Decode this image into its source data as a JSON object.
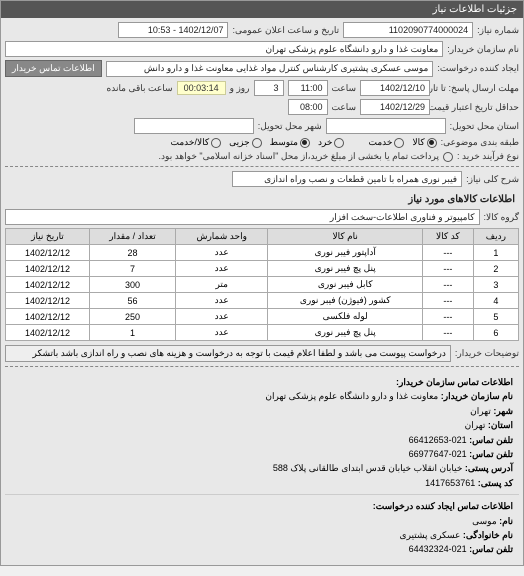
{
  "header": "جزئیات اطلاعات نیاز",
  "form": {
    "request_no_label": "شماره نیاز:",
    "request_no": "1102090774000024",
    "publish_label": "تاریخ و ساعت اعلان عمومی:",
    "publish_value": "1402/12/07 - 10:53",
    "buyer_label": "نام سازمان خریدار:",
    "buyer_value": "معاونت غذا و دارو دانشگاه علوم پزشکی تهران",
    "creator_label": "ایجاد کننده درخواست:",
    "creator_value": "موسی   عسکری پشتیری   کارشناس کنترل مواد غذایی معاونت غذا و دارو دانش",
    "contact_btn": "اطلاعات تماس خریدار",
    "deadline_send_label": "مهلت ارسال پاسخ: تا تاریخ:",
    "deadline_send_date": "1402/12/10",
    "time_label": "ساعت",
    "deadline_send_time": "11:00",
    "days_left": "3",
    "days_left_label": "روز و",
    "countdown": "00:03:14",
    "remain_label": "ساعت باقی مانده",
    "validity_label": "حداقل تاریخ اعتبار قیمت: تا تاریخ:",
    "validity_date": "1402/12/29",
    "validity_time": "08:00",
    "province_label": "استان محل تحویل:",
    "city_label": "شهر محل تحویل:",
    "pack_label": "طبقه بندی موضوعی:",
    "pack_goods": "کالا",
    "pack_service": "خدمت",
    "pack_small": "خرد",
    "pack_medium": "متوسط",
    "pack_partial": "جزیی",
    "pack_both": "کالا/خدمت",
    "process_label": "نوع فرآیند خرید :",
    "process_text": "پرداخت تمام یا بخشی از مبلغ خرید،از محل \"اسناد خزانه اسلامی\" خواهد بود.",
    "desc_label": "شرح کلی نیاز:",
    "desc_value": "فیبر نوری همراه با تامین قطعات و نصب وراه اندازی"
  },
  "goods_section": "اطلاعات کالاهای مورد نیاز",
  "group_label": "گروه کالا:",
  "group_value": "کامپیوتر و فناوری اطلاعات-سخت افزار",
  "table": {
    "headers": [
      "ردیف",
      "کد کالا",
      "نام کالا",
      "واحد شمارش",
      "تعداد / مقدار",
      "تاریخ نیاز"
    ],
    "rows": [
      [
        "1",
        "---",
        "آداپتور فیبر نوری",
        "عدد",
        "28",
        "1402/12/12"
      ],
      [
        "2",
        "---",
        "پنل پچ فیبر نوری",
        "عدد",
        "7",
        "1402/12/12"
      ],
      [
        "3",
        "---",
        "کابل فیبر نوری",
        "متر",
        "300",
        "1402/12/12"
      ],
      [
        "4",
        "---",
        "کشور (فیوژن) فیبر نوری",
        "عدد",
        "56",
        "1402/12/12"
      ],
      [
        "5",
        "---",
        "لوله فلکسی",
        "عدد",
        "250",
        "1402/12/12"
      ],
      [
        "6",
        "---",
        "پنل پچ فیبر نوری",
        "عدد",
        "1",
        "1402/12/12"
      ]
    ]
  },
  "buyer_note_label": "توضیحات خریدار:",
  "buyer_note": "درخواست پیوست می باشد و لطفا اعلام قیمت با توجه به درخواست و هزینه های نصب و راه اندازی باشد باتشکر",
  "org_contact_title": "اطلاعات تماس سازمان خریدار:",
  "org": {
    "name_label": "نام سازمان خریدار:",
    "name": "معاونت غذا و دارو دانشگاه علوم پزشکی تهران",
    "city_label": "شهر:",
    "city": "تهران",
    "province_label": "استان:",
    "province": "تهران",
    "phone_label": "تلفن تماس:",
    "phone": "021-66412653",
    "fax_label": "تلفن تماس:",
    "fax": "021-66977647",
    "address_label": "آدرس پستی:",
    "address": "خیابان انقلاب خیابان قدس ابتدای طالقانی پلاک 588",
    "postal_label": "کد پستی:",
    "postal": "1417653761"
  },
  "req_contact_title": "اطلاعات تماس ایجاد کننده درخواست:",
  "req": {
    "name_label": "نام:",
    "name": "موسی",
    "family_label": "نام خانوادگی:",
    "family": "عسکری پشتیری",
    "phone_label": "تلفن تماس:",
    "phone": "021-64432324"
  }
}
